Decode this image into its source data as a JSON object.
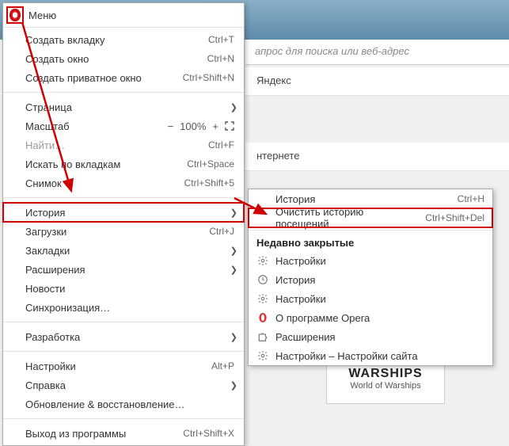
{
  "colors": {
    "accent": "#d00000",
    "arrow": "#d00000"
  },
  "header": {
    "title": "Меню",
    "search_placeholder": "апрос для поиска или веб-адрес",
    "yandex_label": "Яндекс",
    "internet_label": "нтернете",
    "tile_logo": "WARSHIPS",
    "tile_caption": "World of Warships"
  },
  "menu": {
    "items": [
      {
        "label": "Создать вкладку",
        "shortcut": "Ctrl+T"
      },
      {
        "label": "Создать окно",
        "shortcut": "Ctrl+N"
      },
      {
        "label": "Создать приватное окно",
        "shortcut": "Ctrl+Shift+N"
      }
    ],
    "page": {
      "label": "Страница"
    },
    "zoom": {
      "label": "Масштаб",
      "minus": "−",
      "value": "100%",
      "plus": "+"
    },
    "find": {
      "label": "Найти…",
      "shortcut": "Ctrl+F",
      "disabled": true
    },
    "search_tabs": {
      "label": "Искать по вкладкам",
      "shortcut": "Ctrl+Space"
    },
    "snapshot": {
      "label": "Снимок",
      "shortcut": "Ctrl+Shift+5"
    },
    "history": {
      "label": "История"
    },
    "downloads": {
      "label": "Загрузки",
      "shortcut": "Ctrl+J"
    },
    "bookmarks": {
      "label": "Закладки"
    },
    "extensions": {
      "label": "Расширения"
    },
    "news": {
      "label": "Новости"
    },
    "sync": {
      "label": "Синхронизация…"
    },
    "dev": {
      "label": "Разработка"
    },
    "settings": {
      "label": "Настройки",
      "shortcut": "Alt+P"
    },
    "help": {
      "label": "Справка"
    },
    "update": {
      "label": "Обновление & восстановление…"
    },
    "exit": {
      "label": "Выход из программы",
      "shortcut": "Ctrl+Shift+X"
    }
  },
  "submenu": {
    "history": {
      "label": "История",
      "shortcut": "Ctrl+H"
    },
    "clear": {
      "label": "Очистить историю посещений",
      "shortcut": "Ctrl+Shift+Del"
    },
    "recent_heading": "Недавно закрытые",
    "recent": [
      {
        "icon": "gear-icon",
        "label": "Настройки"
      },
      {
        "icon": "clock-icon",
        "label": "История"
      },
      {
        "icon": "gear-icon",
        "label": "Настройки"
      },
      {
        "icon": "opera-icon",
        "label": "О программе Opera"
      },
      {
        "icon": "puzzle-icon",
        "label": "Расширения"
      },
      {
        "icon": "gear-icon",
        "label": "Настройки – Настройки сайта"
      }
    ]
  }
}
